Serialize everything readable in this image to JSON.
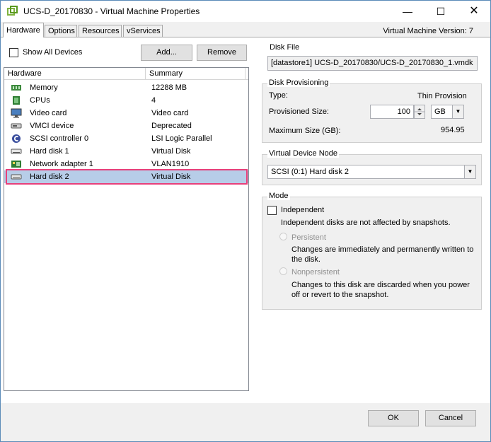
{
  "window": {
    "title": "UCS-D_20170830 - Virtual Machine Properties",
    "controls": {
      "minimize": "—",
      "maximize": "☐",
      "close": "✕"
    }
  },
  "tabs": [
    {
      "label": "Hardware",
      "active": true
    },
    {
      "label": "Options",
      "active": false
    },
    {
      "label": "Resources",
      "active": false
    },
    {
      "label": "vServices",
      "active": false
    }
  ],
  "vm_version": "Virtual Machine Version: 7",
  "hardware_panel": {
    "show_all_devices_label": "Show All Devices",
    "add_button": "Add...",
    "remove_button": "Remove",
    "columns": {
      "hardware": "Hardware",
      "summary": "Summary"
    },
    "devices": [
      {
        "name": "Memory",
        "summary": "12288 MB",
        "icon": "memory-icon"
      },
      {
        "name": "CPUs",
        "summary": "4",
        "icon": "cpu-icon"
      },
      {
        "name": "Video card",
        "summary": "Video card",
        "icon": "monitor-icon"
      },
      {
        "name": "VMCI device",
        "summary": "Deprecated",
        "icon": "device-icon"
      },
      {
        "name": "SCSI controller 0",
        "summary": "LSI Logic Parallel",
        "icon": "scsi-icon"
      },
      {
        "name": "Hard disk 1",
        "summary": "Virtual Disk",
        "icon": "hard-disk-icon"
      },
      {
        "name": "Network adapter 1",
        "summary": "VLAN1910",
        "icon": "network-icon"
      },
      {
        "name": "Hard disk 2",
        "summary": "Virtual Disk",
        "icon": "hard-disk-icon",
        "selected": true
      }
    ]
  },
  "disk_file": {
    "label": "Disk File",
    "value": "[datastore1] UCS-D_20170830/UCS-D_20170830_1.vmdk"
  },
  "disk_provisioning": {
    "label": "Disk Provisioning",
    "type_label": "Type:",
    "type_value": "Thin Provision",
    "provisioned_label": "Provisioned Size:",
    "provisioned_value": "100",
    "unit": "GB",
    "max_label": "Maximum Size (GB):",
    "max_value": "954.95"
  },
  "virtual_device_node": {
    "label": "Virtual Device Node",
    "value": "SCSI (0:1) Hard disk 2"
  },
  "mode": {
    "label": "Mode",
    "independent_label": "Independent",
    "independent_desc": "Independent disks are not affected by snapshots.",
    "persistent_label": "Persistent",
    "persistent_desc_1": "Changes are immediately and permanently written to",
    "persistent_desc_2": "the disk.",
    "nonpersistent_label": "Nonpersistent",
    "nonpersistent_desc_1": "Changes to this disk are discarded when you power",
    "nonpersistent_desc_2": "off or revert to the snapshot."
  },
  "footer": {
    "ok": "OK",
    "cancel": "Cancel"
  },
  "colors": {
    "selection": "#b7cde8",
    "highlight": "#e8407a"
  }
}
